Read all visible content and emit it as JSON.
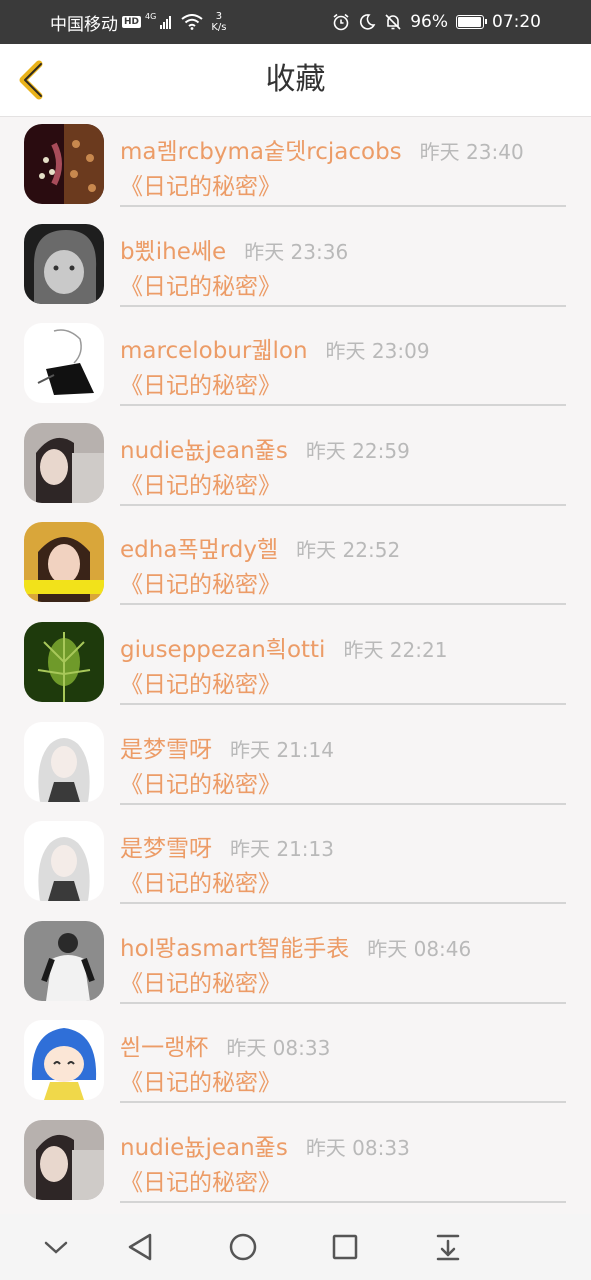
{
  "status_bar": {
    "carrier": "中国移动",
    "hd": "HD",
    "network": "4G",
    "speed_value": "3",
    "speed_unit": "K/s",
    "battery": "96%",
    "time": "07:20"
  },
  "header": {
    "title": "收藏"
  },
  "favorites": [
    {
      "name": "ma렘rcbyma숱뎃rcjacobs",
      "time": "昨天 23:40",
      "book": "《日记的秘密》"
    },
    {
      "name": "b뾨ihe쎄e",
      "time": "昨天 23:36",
      "book": "《日记的秘密》"
    },
    {
      "name": "marcelobur궯lon",
      "time": "昨天 23:09",
      "book": "《日记的秘密》"
    },
    {
      "name": "nudie뇺jean죭s",
      "time": "昨天 22:59",
      "book": "《日记的秘密》"
    },
    {
      "name": "edha폭멒rdy헬",
      "time": "昨天 22:52",
      "book": "《日记的秘密》"
    },
    {
      "name": "giuseppezan흭otti",
      "time": "昨天 22:21",
      "book": "《日记的秘密》"
    },
    {
      "name": "是梦雪呀",
      "time": "昨天 21:14",
      "book": "《日记的秘密》"
    },
    {
      "name": "是梦雪呀",
      "time": "昨天 21:13",
      "book": "《日记的秘密》"
    },
    {
      "name": "hol뫙asmart智能手表",
      "time": "昨天 08:46",
      "book": "《日记的秘密》"
    },
    {
      "name": "씐一랭杯",
      "time": "昨天 08:33",
      "book": "《日记的秘密》"
    },
    {
      "name": "nudie뇺jean죭s",
      "time": "昨天 08:33",
      "book": "《日记的秘密》"
    }
  ],
  "colors": {
    "accent_orange": "#ec9c67",
    "time_gray": "#b9b9b9",
    "status_bar_bg": "#3a3a3a",
    "back_arrow": "#e9b21a"
  },
  "icons": {
    "back": "chevron-left-icon",
    "nav": [
      "chevron-down-icon",
      "back-triangle-icon",
      "home-circle-icon",
      "recents-square-icon",
      "download-tray-icon"
    ]
  }
}
